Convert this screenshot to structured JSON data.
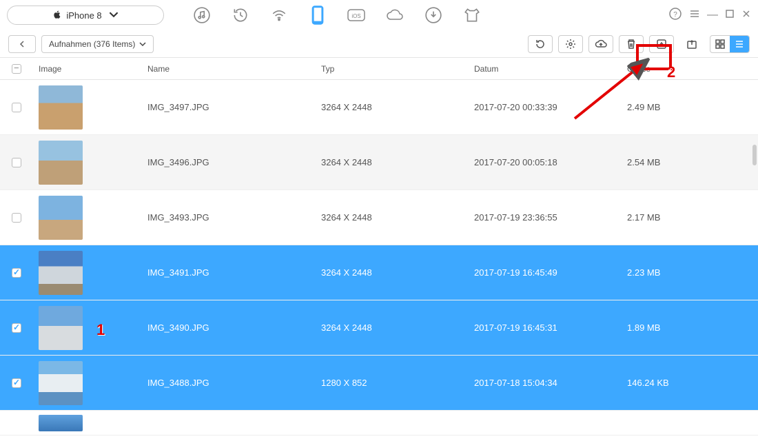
{
  "device_name": "iPhone 8",
  "breadcrumb": "Aufnahmen (376 Items)",
  "columns": {
    "image": "Image",
    "name": "Name",
    "typ": "Typ",
    "datum": "Datum",
    "groesse": "Größe"
  },
  "annotations": {
    "one": "1",
    "two": "2"
  },
  "rows": [
    {
      "name": "IMG_3497.JPG",
      "typ": "3264 X 2448",
      "datum": "2017-07-20 00:33:39",
      "size": "2.49 MB",
      "checked": false,
      "alt": false,
      "selected": false,
      "thumb": "th-a"
    },
    {
      "name": "IMG_3496.JPG",
      "typ": "3264 X 2448",
      "datum": "2017-07-20 00:05:18",
      "size": "2.54 MB",
      "checked": false,
      "alt": true,
      "selected": false,
      "thumb": "th-b"
    },
    {
      "name": "IMG_3493.JPG",
      "typ": "3264 X 2448",
      "datum": "2017-07-19 23:36:55",
      "size": "2.17 MB",
      "checked": false,
      "alt": false,
      "selected": false,
      "thumb": "th-c"
    },
    {
      "name": "IMG_3491.JPG",
      "typ": "3264 X 2448",
      "datum": "2017-07-19 16:45:49",
      "size": "2.23 MB",
      "checked": true,
      "alt": false,
      "selected": true,
      "thumb": "th-d"
    },
    {
      "name": "IMG_3490.JPG",
      "typ": "3264 X 2448",
      "datum": "2017-07-19 16:45:31",
      "size": "1.89 MB",
      "checked": true,
      "alt": false,
      "selected": true,
      "thumb": "th-e"
    },
    {
      "name": "IMG_3488.JPG",
      "typ": "1280 X 852",
      "datum": "2017-07-18 15:04:34",
      "size": "146.24 KB",
      "checked": true,
      "alt": false,
      "selected": true,
      "thumb": "th-f"
    }
  ]
}
